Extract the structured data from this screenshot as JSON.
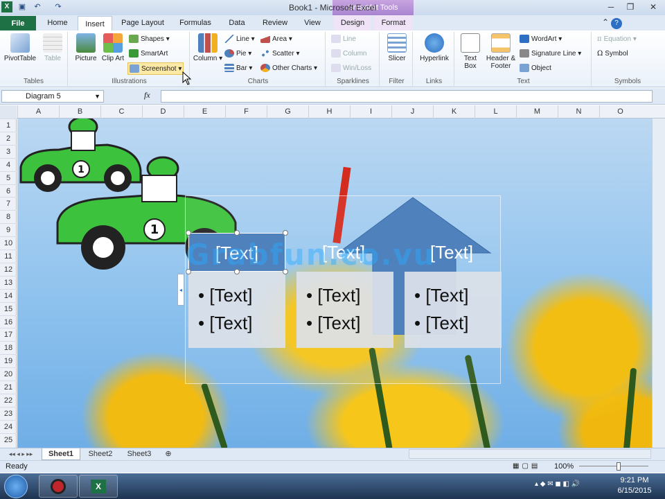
{
  "window": {
    "title": "Book1 - Microsoft Excel",
    "context_tools": "SmartArt Tools"
  },
  "tabs": [
    {
      "label": "File"
    },
    {
      "label": "Home"
    },
    {
      "label": "Insert"
    },
    {
      "label": "Page Layout"
    },
    {
      "label": "Formulas"
    },
    {
      "label": "Data"
    },
    {
      "label": "Review"
    },
    {
      "label": "View"
    },
    {
      "label": "Design"
    },
    {
      "label": "Format"
    }
  ],
  "ribbon": {
    "tables": {
      "label": "Tables",
      "pivot": "PivotTable",
      "table": "Table"
    },
    "illustrations": {
      "label": "Illustrations",
      "picture": "Picture",
      "clip_art": "Clip Art",
      "shapes": "Shapes",
      "smartart": "SmartArt",
      "screenshot": "Screenshot"
    },
    "charts": {
      "label": "Charts",
      "column": "Column",
      "line": "Line",
      "pie": "Pie",
      "bar": "Bar",
      "area": "Area",
      "scatter": "Scatter",
      "other": "Other Charts"
    },
    "sparklines": {
      "label": "Sparklines",
      "line": "Line",
      "column": "Column",
      "winloss": "Win/Loss"
    },
    "filter": {
      "label": "Filter",
      "slicer": "Slicer"
    },
    "links": {
      "label": "Links",
      "hyperlink": "Hyperlink"
    },
    "text": {
      "label": "Text",
      "text_box": "Text Box",
      "header_footer": "Header & Footer",
      "wordart": "WordArt",
      "signature": "Signature Line",
      "object": "Object"
    },
    "symbols": {
      "label": "Symbols",
      "equation": "Equation",
      "symbol": "Symbol"
    }
  },
  "formula_bar": {
    "name_box": "Diagram 5",
    "fx": "fx",
    "value": ""
  },
  "columns": [
    "A",
    "B",
    "C",
    "D",
    "E",
    "F",
    "G",
    "H",
    "I",
    "J",
    "K",
    "L",
    "M",
    "N",
    "O"
  ],
  "rows": [
    "1",
    "2",
    "3",
    "4",
    "5",
    "6",
    "7",
    "8",
    "9",
    "10",
    "11",
    "12",
    "13",
    "14",
    "15",
    "16",
    "17",
    "18",
    "19",
    "20",
    "21",
    "22",
    "23",
    "24",
    "25"
  ],
  "smartart": {
    "shapes": [
      {
        "header": "[Text]",
        "bullets": [
          "[Text]",
          "[Text]"
        ]
      },
      {
        "header": "[Text]",
        "bullets": [
          "[Text]",
          "[Text]"
        ]
      },
      {
        "header": "[Text]",
        "bullets": [
          "[Text]",
          "[Text]"
        ]
      }
    ],
    "watermark": "Grabfun.co.vu"
  },
  "car_numbers": [
    "1",
    "1"
  ],
  "sheets": [
    "Sheet1",
    "Sheet2",
    "Sheet3"
  ],
  "status": {
    "ready": "Ready",
    "zoom": "100%"
  },
  "taskbar": {
    "time": "9:21 PM",
    "date": "6/15/2015"
  },
  "colors": {
    "excel_green": "#1e7145",
    "smartart_blue": "#4f81bd",
    "ribbon_bg": "#dfe9f5",
    "tulip_yellow": "#f5c417"
  },
  "icons": [
    "excel-icon",
    "save-icon",
    "undo-icon",
    "redo-icon",
    "minimize-icon",
    "restore-icon",
    "close-icon",
    "help-icon",
    "windows-start-icon"
  ]
}
